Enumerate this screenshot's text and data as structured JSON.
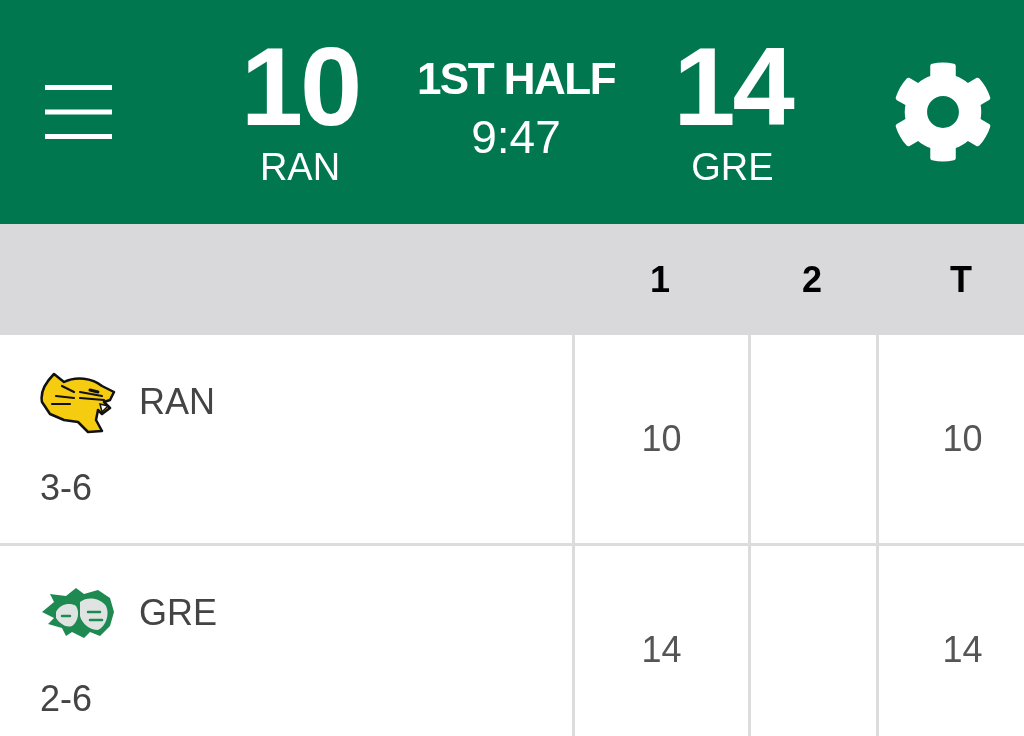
{
  "scoreboard": {
    "home": {
      "score": "10",
      "team": "RAN"
    },
    "period": "1ST HALF",
    "clock": "9:47",
    "away": {
      "score": "14",
      "team": "GRE"
    }
  },
  "table": {
    "periods": [
      "1",
      "2"
    ],
    "total_label": "T",
    "rows": [
      {
        "team": "RAN",
        "kind": "tiger",
        "record": "3-6",
        "period_scores": [
          "10"
        ],
        "total": "10"
      },
      {
        "team": "GRE",
        "kind": "lions",
        "record": "2-6",
        "period_scores": [
          "14"
        ],
        "total": "14"
      }
    ]
  }
}
